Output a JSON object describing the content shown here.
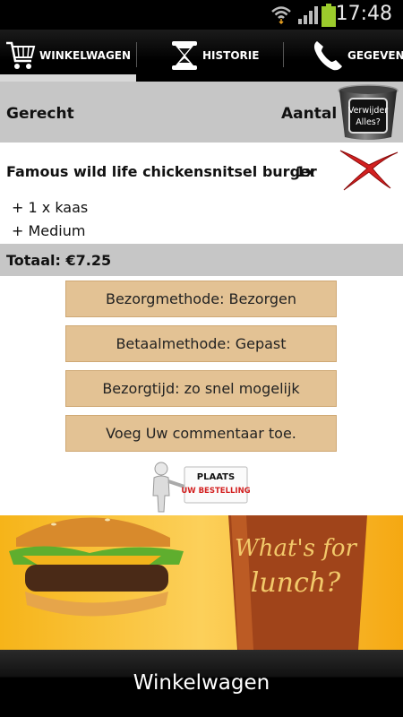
{
  "status_bar": {
    "time": "17:48"
  },
  "tabs": [
    {
      "label": "WINKELWAGEN",
      "icon": "cart-icon",
      "active": true
    },
    {
      "label": "HISTORIE",
      "icon": "hourglass-icon",
      "active": false
    },
    {
      "label": "GEGEVENS",
      "icon": "phone-icon",
      "active": false
    }
  ],
  "table_header": {
    "dish": "Gerecht",
    "quantity": "Aantal",
    "delete_all": "Verwijder Alles?"
  },
  "order_item": {
    "name": "Famous wild life chickensnitsel burger",
    "quantity": "1x",
    "options": [
      "+ 1 x kaas",
      "+ Medium"
    ]
  },
  "total": "Totaal: €7.25",
  "buttons": {
    "delivery_method": "Bezorgmethode: Bezorgen",
    "payment_method": "Betaalmethode: Gepast",
    "delivery_time": "Bezorgtijd: zo snel mogelijk",
    "add_comment": "Voeg Uw commentaar toe."
  },
  "place_order": {
    "line1": "PLAATS",
    "line2": "UW BESTELLING"
  },
  "banner": {
    "cup_text_1": "What's for",
    "cup_text_2": "lunch?"
  },
  "bottom_title": "Winkelwagen",
  "colors": {
    "button_bg": "#e3c294",
    "header_bg": "#c6c6c6",
    "accent_red": "#d32020"
  }
}
